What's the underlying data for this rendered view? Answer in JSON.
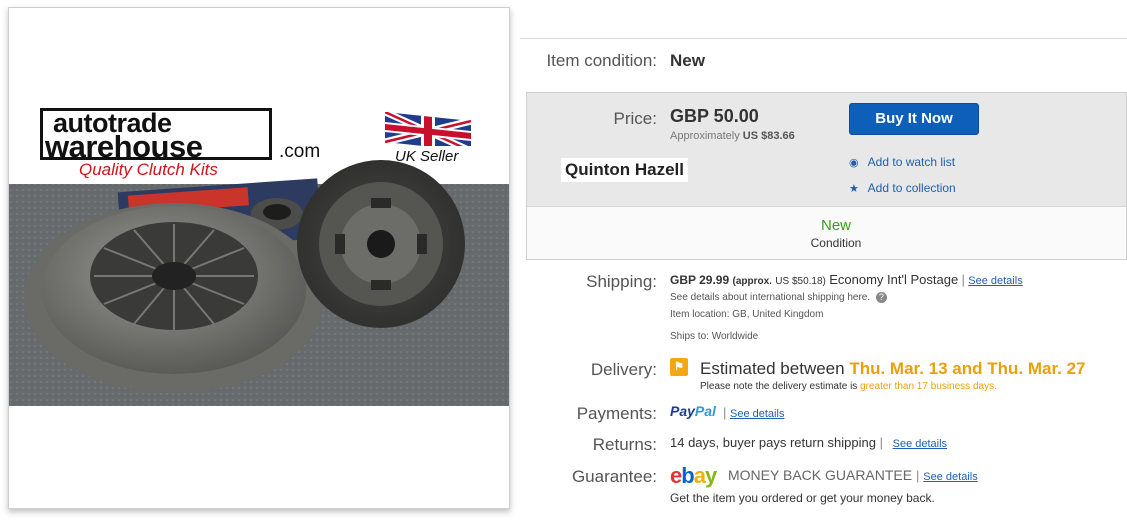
{
  "image": {
    "brand_line1": "autotrade",
    "brand_line2": "warehouse",
    "brand_com": ".com",
    "tagline": "Quality Clutch Kits",
    "uk_seller": "UK Seller"
  },
  "condition": {
    "label": "Item condition:",
    "value": "New"
  },
  "buy_box": {
    "price_label": "Price:",
    "price": "GBP 50.00",
    "approx_prefix": "Approximately",
    "approx_value": "US $83.66",
    "seller": "Quinton Hazell",
    "buy_button": "Buy It Now",
    "watch_link": "Add to watch list",
    "collection_link": "Add to collection",
    "condition_value": "New",
    "condition_label": "Condition"
  },
  "shipping": {
    "label": "Shipping:",
    "price": "GBP 29.99",
    "approx": "(approx.",
    "approx_value": "US $50.18)",
    "method": "Economy Int'l Postage",
    "see_details": "See details",
    "intl_note": "See details about international shipping here.",
    "location": "Item location:  GB, United Kingdom",
    "ships_to": "Ships to:  Worldwide"
  },
  "delivery": {
    "label": "Delivery:",
    "estimated_prefix": "Estimated between",
    "estimated_dates": "Thu. Mar. 13 and Thu. Mar. 27",
    "note_prefix": "Please note the delivery estimate is",
    "note_highlight": "greater than 17 business days."
  },
  "payments": {
    "label": "Payments:",
    "paypal_1": "Pay",
    "paypal_2": "Pal",
    "see_details": "See details"
  },
  "returns": {
    "label": "Returns:",
    "text": "14 days, buyer pays return shipping",
    "see_details": "See details"
  },
  "guarantee": {
    "label": "Guarantee:",
    "logo": [
      "e",
      "b",
      "a",
      "y"
    ],
    "title": "MONEY BACK GUARANTEE",
    "see_details": "See details",
    "sub": "Get the item you ordered or get your money back."
  },
  "colors": {
    "accent": "#0e5fb9",
    "highlight": "#e8a00e",
    "condition_green": "#3a9b24"
  }
}
